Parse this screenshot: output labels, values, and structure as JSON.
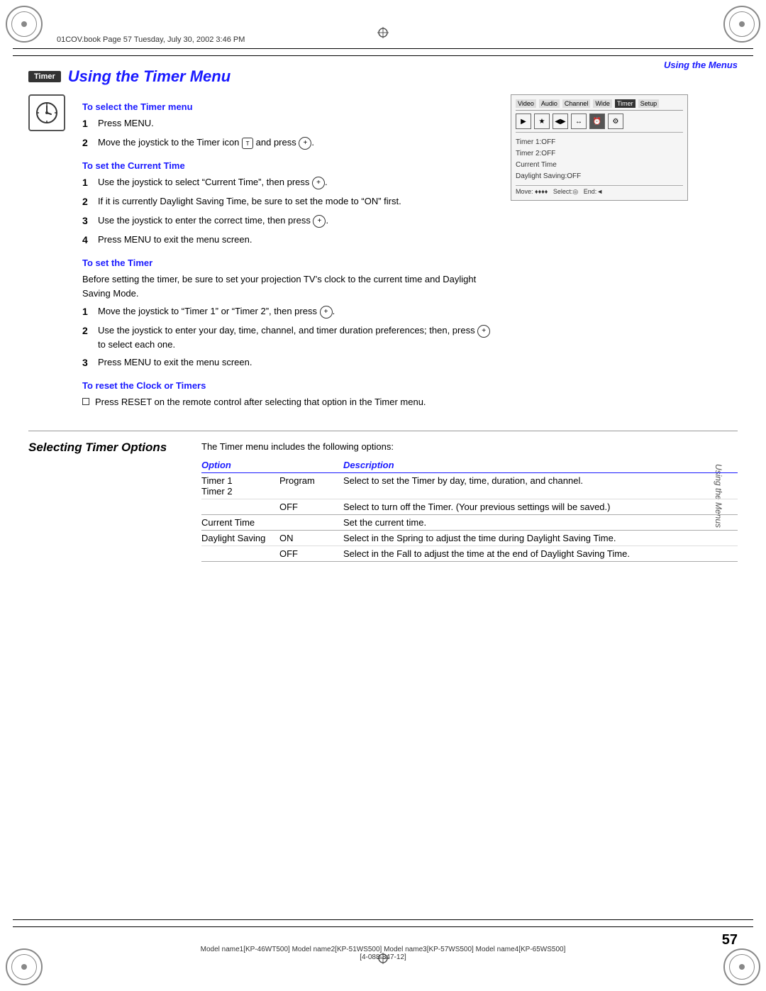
{
  "page": {
    "file_info": "01COV.book  Page 57  Tuesday, July 30, 2002  3:46 PM",
    "header_section": "Using the Menus",
    "side_text": "Using the Menus",
    "page_number": "57",
    "footer_models": "Model name1[KP-46WT500] Model name2[KP-51WS500] Model name3[KP-57WS500] Model name4[KP-65WS500]",
    "footer_part": "[4-088-847-12]"
  },
  "section_title": {
    "badge": "Timer",
    "title": "Using the Timer Menu"
  },
  "select_timer_menu": {
    "heading": "To select the Timer menu",
    "steps": [
      {
        "num": "1",
        "text": "Press MENU."
      },
      {
        "num": "2",
        "text": "Move the joystick to the Timer icon  and press  ."
      }
    ]
  },
  "set_current_time": {
    "heading": "To set the Current Time",
    "steps": [
      {
        "num": "1",
        "text": "Use the joystick to select “Current Time”, then press  ."
      },
      {
        "num": "2",
        "text": "If it is currently Daylight Saving Time, be sure to set the mode to “ON” first."
      },
      {
        "num": "3",
        "text": "Use the joystick to enter the correct time, then press  ."
      },
      {
        "num": "4",
        "text": "Press MENU to exit the menu screen."
      }
    ]
  },
  "set_timer": {
    "heading": "To set the Timer",
    "intro": "Before setting the timer, be sure to set your projection TV’s clock to the current time and Daylight Saving Mode.",
    "steps": [
      {
        "num": "1",
        "text": "Move the joystick to “Timer 1” or “Timer 2”, then press  ."
      },
      {
        "num": "2",
        "text": "Use the joystick to enter your day, time, channel, and timer duration preferences; then, press   to select each one."
      },
      {
        "num": "3",
        "text": "Press MENU to exit the menu screen."
      }
    ]
  },
  "reset_clock": {
    "heading": "To reset the Clock or Timers",
    "bullet": "Press RESET on the remote control after selecting that option in the Timer menu."
  },
  "tv_menu": {
    "tabs": [
      "Video",
      "Audio",
      "Channel",
      "Wide",
      "Timer",
      "Setup"
    ],
    "active_tab": "Timer",
    "icons": [
      "▶",
      "★",
      "◀▶",
      "↔",
      "⏰",
      "⚙"
    ],
    "menu_items": [
      "Timer 1:OFF",
      "Timer 2:OFF",
      "Current Time",
      "Daylight Saving:OFF"
    ],
    "footer": "Move: ✦✦✦   Select:    End:"
  },
  "selecting_section": {
    "title": "Selecting Timer Options",
    "intro": "The Timer menu includes the following options:",
    "table": {
      "headers": [
        "Option",
        "Description"
      ],
      "rows": [
        {
          "option": "Timer 1",
          "sub_option": "Program",
          "description": "Select to set the Timer by day, time, duration, and channel.",
          "rowspan": true
        },
        {
          "option": "Timer 2",
          "sub_option": "",
          "description": "",
          "continuation": true
        },
        {
          "option": "",
          "sub_option": "OFF",
          "description": "Select to turn off the Timer. (Your previous settings will be saved.)"
        },
        {
          "option": "Current Time",
          "sub_option": "",
          "description": "Set the current time."
        },
        {
          "option": "Daylight Saving",
          "sub_option": "ON",
          "description": "Select in the Spring to adjust the time during Daylight Saving Time.",
          "rowspan": true
        },
        {
          "option": "",
          "sub_option": "OFF",
          "description": "Select in the Fall to adjust the time at the end of Daylight Saving Time."
        }
      ]
    }
  }
}
